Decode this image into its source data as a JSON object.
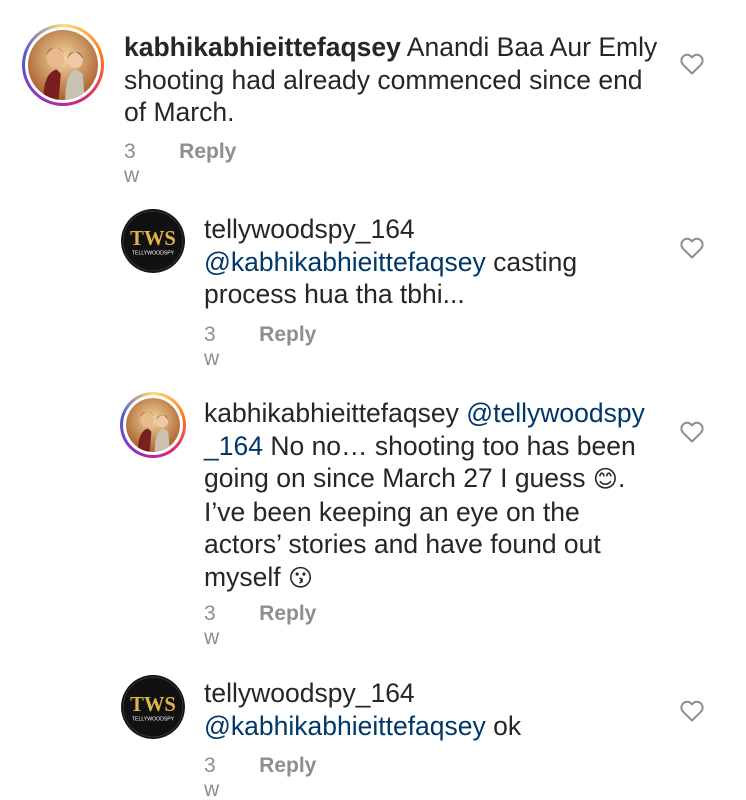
{
  "comments": [
    {
      "username": "kabhikabhieittefaqsey",
      "mention": "",
      "text": "Anandi Baa Aur Emly shooting had already commenced since end of March.",
      "time": "3 w",
      "reply_label": "Reply",
      "avatar_icon": "couple-avatar"
    },
    {
      "username": "tellywoodspy_164",
      "mention": "@kabhikabhieittefaqsey",
      "text": "casting process hua tha tbhi...",
      "time": "3 w",
      "reply_label": "Reply",
      "avatar_icon": "tws-logo-avatar",
      "logo_text": "TWS",
      "logo_subtext": "TELLYWOODSPY"
    },
    {
      "username": "kabhikabhieittefaqsey",
      "mention": "@tellywoodspy _164",
      "text_a": "No no… shooting too has been going on since March 27 I guess",
      "emoji_a": "😊",
      "text_b": ". I’ve been keeping an eye on the actors’ stories and have found out myself",
      "emoji_b": "😗",
      "time": "3 w",
      "reply_label": "Reply",
      "avatar_icon": "couple-avatar"
    },
    {
      "username": "tellywoodspy_164",
      "mention": "@kabhikabhieittefaqsey",
      "text": "ok",
      "time": "3 w",
      "reply_label": "Reply",
      "avatar_icon": "tws-logo-avatar",
      "logo_text": "TWS",
      "logo_subtext": "TELLYWOODSPY"
    }
  ],
  "colors": {
    "username": "#262626",
    "mention": "#00376b",
    "meta": "#8e8e8e",
    "heart_stroke": "#8e8e8e"
  },
  "icons": [
    "heart-outline-icon",
    "couple-avatar",
    "tws-logo-avatar"
  ]
}
